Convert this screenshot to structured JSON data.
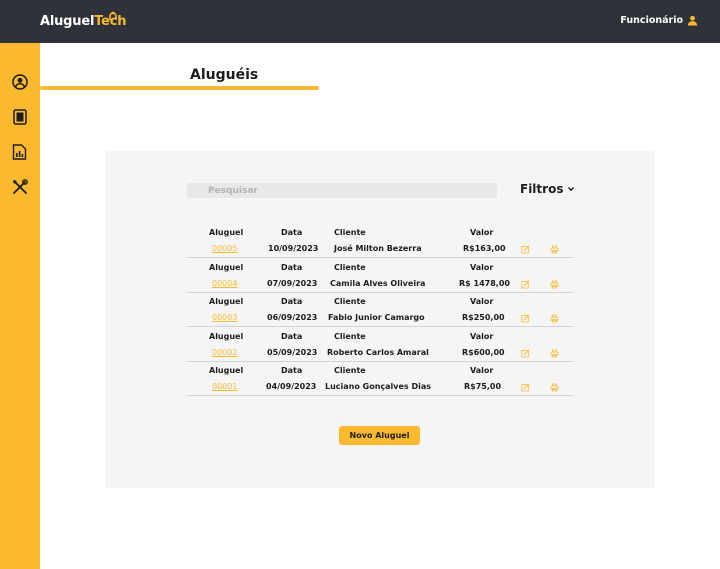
{
  "app": {
    "logo_main": "Aluguel",
    "logo_accent": "Tech",
    "user_label": "Funcionário"
  },
  "page": {
    "title": "Aluguéis"
  },
  "colors": {
    "accent": "#fbb92f",
    "topbar": "#2f3339",
    "panel": "#f5f5f5"
  },
  "sidebar": {
    "icons": [
      "user-circle-icon",
      "document-icon",
      "report-chart-icon",
      "tools-icon"
    ]
  },
  "search": {
    "placeholder": "Pesquisar"
  },
  "filters": {
    "label": "Filtros"
  },
  "table": {
    "headers": {
      "aluguel": "Aluguel",
      "data": "Data",
      "cliente": "Cliente",
      "valor": "Valor"
    },
    "rows": [
      {
        "aluguel": "00005",
        "data": "10/09/2023",
        "cliente": "José Milton Bezerra",
        "valor": "R$163,00"
      },
      {
        "aluguel": "00004",
        "data": "07/09/2023",
        "cliente": "Camila Alves Oliveira",
        "valor": "R$ 1478,00"
      },
      {
        "aluguel": "00003",
        "data": "06/09/2023",
        "cliente": "Fabio Junior Camargo",
        "valor": "R$250,00"
      },
      {
        "aluguel": "00002",
        "data": "05/09/2023",
        "cliente": "Roberto Carlos Amaral",
        "valor": "R$600,00"
      },
      {
        "aluguel": "00001",
        "data": "04/09/2023",
        "cliente": "Luciano Gonçalves Dias",
        "valor": "R$75,00"
      }
    ]
  },
  "actions": {
    "new_rental": "Novo Aluguel"
  }
}
